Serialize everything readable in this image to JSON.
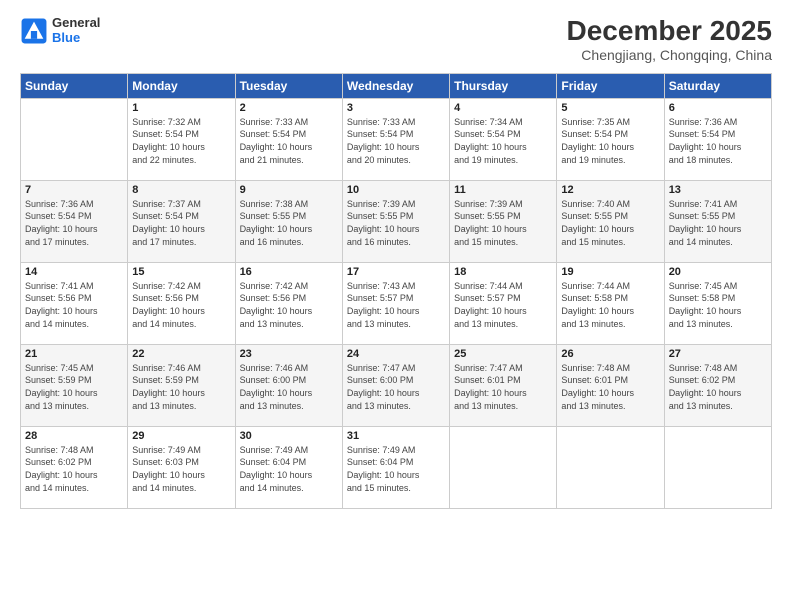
{
  "logo": {
    "line1": "General",
    "line2": "Blue"
  },
  "title": "December 2025",
  "location": "Chengjiang, Chongqing, China",
  "days_of_week": [
    "Sunday",
    "Monday",
    "Tuesday",
    "Wednesday",
    "Thursday",
    "Friday",
    "Saturday"
  ],
  "weeks": [
    [
      {
        "day": "",
        "info": ""
      },
      {
        "day": "1",
        "info": "Sunrise: 7:32 AM\nSunset: 5:54 PM\nDaylight: 10 hours\nand 22 minutes."
      },
      {
        "day": "2",
        "info": "Sunrise: 7:33 AM\nSunset: 5:54 PM\nDaylight: 10 hours\nand 21 minutes."
      },
      {
        "day": "3",
        "info": "Sunrise: 7:33 AM\nSunset: 5:54 PM\nDaylight: 10 hours\nand 20 minutes."
      },
      {
        "day": "4",
        "info": "Sunrise: 7:34 AM\nSunset: 5:54 PM\nDaylight: 10 hours\nand 19 minutes."
      },
      {
        "day": "5",
        "info": "Sunrise: 7:35 AM\nSunset: 5:54 PM\nDaylight: 10 hours\nand 19 minutes."
      },
      {
        "day": "6",
        "info": "Sunrise: 7:36 AM\nSunset: 5:54 PM\nDaylight: 10 hours\nand 18 minutes."
      }
    ],
    [
      {
        "day": "7",
        "info": "Sunrise: 7:36 AM\nSunset: 5:54 PM\nDaylight: 10 hours\nand 17 minutes."
      },
      {
        "day": "8",
        "info": "Sunrise: 7:37 AM\nSunset: 5:54 PM\nDaylight: 10 hours\nand 17 minutes."
      },
      {
        "day": "9",
        "info": "Sunrise: 7:38 AM\nSunset: 5:55 PM\nDaylight: 10 hours\nand 16 minutes."
      },
      {
        "day": "10",
        "info": "Sunrise: 7:39 AM\nSunset: 5:55 PM\nDaylight: 10 hours\nand 16 minutes."
      },
      {
        "day": "11",
        "info": "Sunrise: 7:39 AM\nSunset: 5:55 PM\nDaylight: 10 hours\nand 15 minutes."
      },
      {
        "day": "12",
        "info": "Sunrise: 7:40 AM\nSunset: 5:55 PM\nDaylight: 10 hours\nand 15 minutes."
      },
      {
        "day": "13",
        "info": "Sunrise: 7:41 AM\nSunset: 5:55 PM\nDaylight: 10 hours\nand 14 minutes."
      }
    ],
    [
      {
        "day": "14",
        "info": "Sunrise: 7:41 AM\nSunset: 5:56 PM\nDaylight: 10 hours\nand 14 minutes."
      },
      {
        "day": "15",
        "info": "Sunrise: 7:42 AM\nSunset: 5:56 PM\nDaylight: 10 hours\nand 14 minutes."
      },
      {
        "day": "16",
        "info": "Sunrise: 7:42 AM\nSunset: 5:56 PM\nDaylight: 10 hours\nand 13 minutes."
      },
      {
        "day": "17",
        "info": "Sunrise: 7:43 AM\nSunset: 5:57 PM\nDaylight: 10 hours\nand 13 minutes."
      },
      {
        "day": "18",
        "info": "Sunrise: 7:44 AM\nSunset: 5:57 PM\nDaylight: 10 hours\nand 13 minutes."
      },
      {
        "day": "19",
        "info": "Sunrise: 7:44 AM\nSunset: 5:58 PM\nDaylight: 10 hours\nand 13 minutes."
      },
      {
        "day": "20",
        "info": "Sunrise: 7:45 AM\nSunset: 5:58 PM\nDaylight: 10 hours\nand 13 minutes."
      }
    ],
    [
      {
        "day": "21",
        "info": "Sunrise: 7:45 AM\nSunset: 5:59 PM\nDaylight: 10 hours\nand 13 minutes."
      },
      {
        "day": "22",
        "info": "Sunrise: 7:46 AM\nSunset: 5:59 PM\nDaylight: 10 hours\nand 13 minutes."
      },
      {
        "day": "23",
        "info": "Sunrise: 7:46 AM\nSunset: 6:00 PM\nDaylight: 10 hours\nand 13 minutes."
      },
      {
        "day": "24",
        "info": "Sunrise: 7:47 AM\nSunset: 6:00 PM\nDaylight: 10 hours\nand 13 minutes."
      },
      {
        "day": "25",
        "info": "Sunrise: 7:47 AM\nSunset: 6:01 PM\nDaylight: 10 hours\nand 13 minutes."
      },
      {
        "day": "26",
        "info": "Sunrise: 7:48 AM\nSunset: 6:01 PM\nDaylight: 10 hours\nand 13 minutes."
      },
      {
        "day": "27",
        "info": "Sunrise: 7:48 AM\nSunset: 6:02 PM\nDaylight: 10 hours\nand 13 minutes."
      }
    ],
    [
      {
        "day": "28",
        "info": "Sunrise: 7:48 AM\nSunset: 6:02 PM\nDaylight: 10 hours\nand 14 minutes."
      },
      {
        "day": "29",
        "info": "Sunrise: 7:49 AM\nSunset: 6:03 PM\nDaylight: 10 hours\nand 14 minutes."
      },
      {
        "day": "30",
        "info": "Sunrise: 7:49 AM\nSunset: 6:04 PM\nDaylight: 10 hours\nand 14 minutes."
      },
      {
        "day": "31",
        "info": "Sunrise: 7:49 AM\nSunset: 6:04 PM\nDaylight: 10 hours\nand 15 minutes."
      },
      {
        "day": "",
        "info": ""
      },
      {
        "day": "",
        "info": ""
      },
      {
        "day": "",
        "info": ""
      }
    ]
  ]
}
